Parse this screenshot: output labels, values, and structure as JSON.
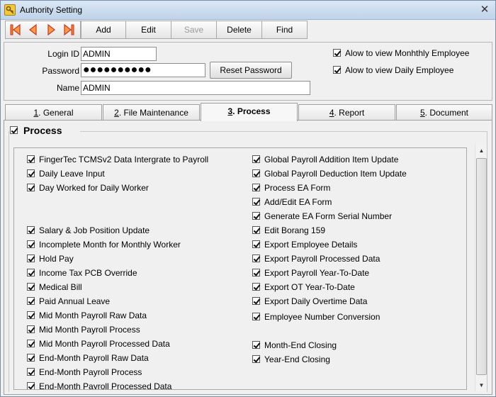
{
  "window": {
    "title": "Authority Setting",
    "close_glyph": "✕"
  },
  "toolbar": {
    "nav_icons": [
      "first-record-icon",
      "previous-record-icon",
      "next-record-icon",
      "last-record-icon"
    ],
    "buttons": [
      {
        "label": "Add",
        "enabled": true
      },
      {
        "label": "Edit",
        "enabled": true
      },
      {
        "label": "Save",
        "enabled": false
      },
      {
        "label": "Delete",
        "enabled": true
      },
      {
        "label": "Find",
        "enabled": true
      }
    ]
  },
  "form": {
    "login_id_label": "Login ID",
    "login_id_value": "ADMIN",
    "password_label": "Password",
    "password_value": "●●●●●●●●●●",
    "name_label": "Name",
    "name_value": "ADMIN",
    "reset_password_label": "Reset Password",
    "options": [
      {
        "label": "Alow to view Monhthly Employee",
        "checked": true
      },
      {
        "label": "Alow to view Daily Employee",
        "checked": true
      }
    ]
  },
  "tabs": [
    {
      "num": "1",
      "label": ". General",
      "active": false
    },
    {
      "num": "2",
      "label": ". File Maintenance",
      "active": false
    },
    {
      "num": "3",
      "label": ". Process",
      "active": true
    },
    {
      "num": "4",
      "label": ". Report",
      "active": false
    },
    {
      "num": "5",
      "label": ". Document",
      "active": false
    }
  ],
  "process": {
    "section_title": "Process",
    "section_checked": true,
    "left_items": [
      "FingerTec TCMSv2 Data Intergrate to Payroll",
      "Daily Leave Input",
      "Day Worked for Daily Worker",
      "",
      "",
      "Salary & Job Position Update",
      "Incomplete Month for Monthly Worker",
      "Hold Pay",
      "Income Tax PCB Override",
      "Medical Bill",
      "Paid Annual Leave",
      "Mid Month Payroll Raw Data",
      "Mid Month Payroll Process",
      "Mid Month Payroll Processed Data",
      "End-Month Payroll Raw Data",
      "End-Month Payroll Process",
      "End-Month Payroll Processed Data"
    ],
    "right_items": [
      "Global Payroll Addition Item Update",
      "Global Payroll Deduction Item Update",
      "Process EA Form",
      "Add/Edit EA Form",
      "Generate EA Form Serial Number",
      "Edit Borang 159",
      "Export Employee Details",
      "Export Payroll Processed Data",
      "Export Payroll Year-To-Date",
      "Export OT Year-To-Date",
      "Export Daily Overtime Data",
      "Employee Number Conversion",
      "",
      "Month-End Closing",
      "Year-End Closing"
    ]
  }
}
